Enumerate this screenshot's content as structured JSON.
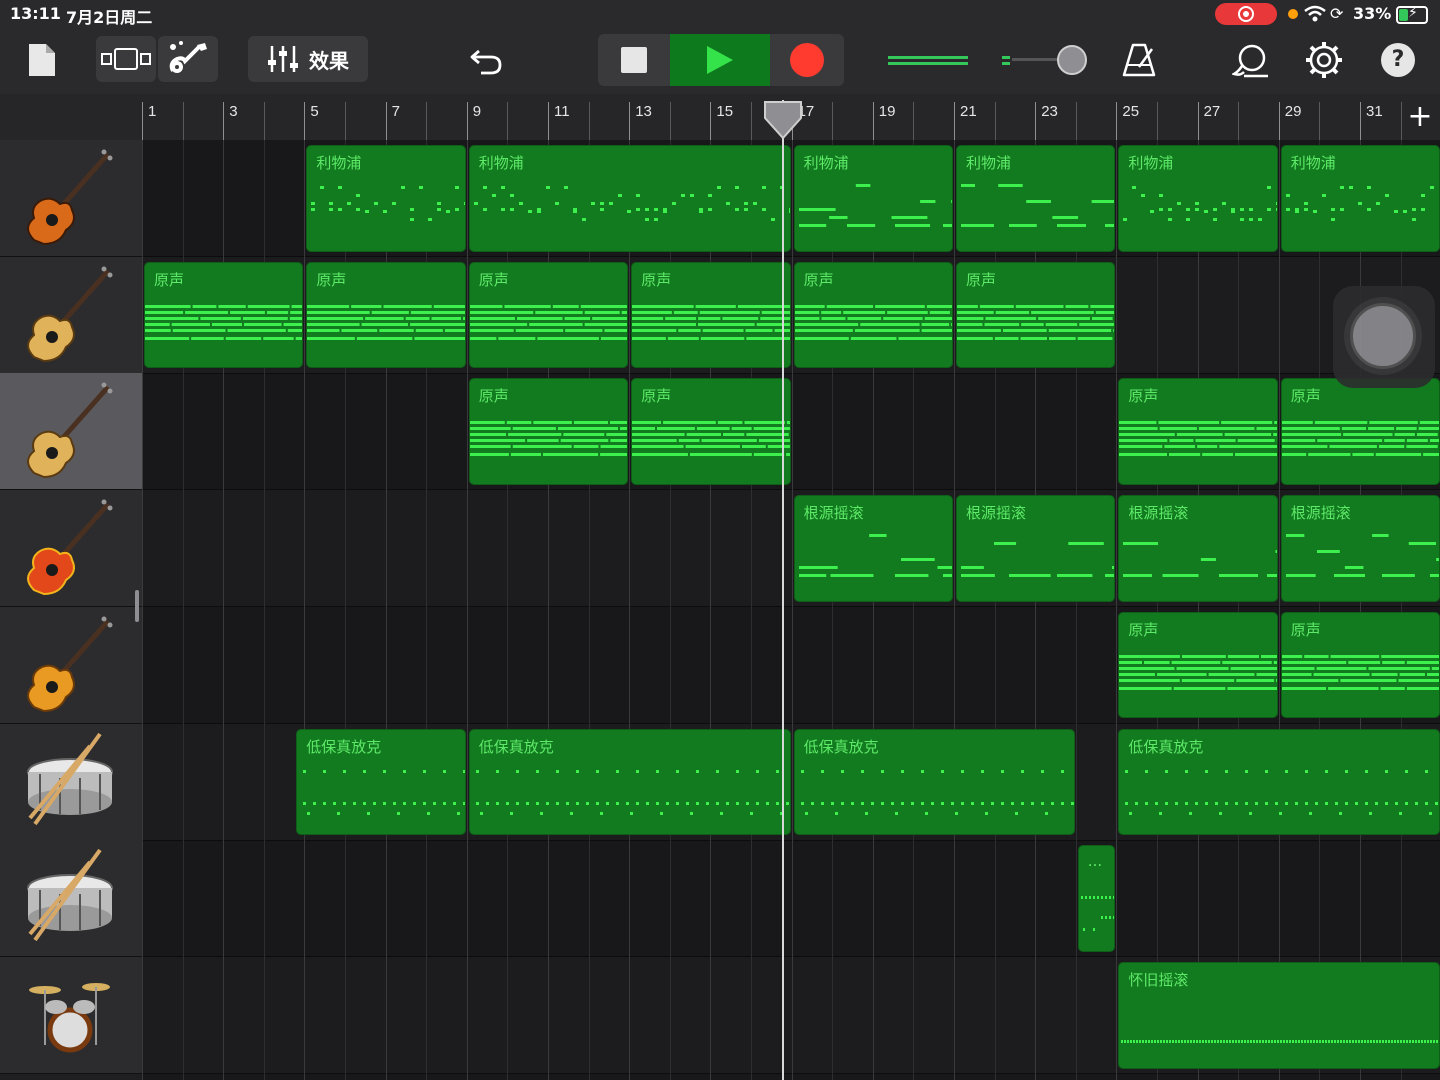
{
  "status_bar": {
    "time": "13:11",
    "date": "7月2日周二",
    "battery_percent": "33%",
    "battery_level": 0.33,
    "recording_indicator": "screen-recording-icon",
    "colors": {
      "record_pill": "#e8383a",
      "battery_fill": "#34c759",
      "mic_dot": "#ff9f0a"
    }
  },
  "toolbar": {
    "effects_label": "效果",
    "icons": [
      "document-icon",
      "view-toggle-icon",
      "instrument-guitar-icon",
      "mixer-sliders-icon",
      "undo-icon",
      "stop-icon",
      "play-icon",
      "record-icon",
      "master-volume-slider",
      "metronome-icon",
      "loop-browser-icon",
      "settings-gear-icon",
      "help-icon"
    ],
    "master_volume_level": 0.9,
    "colors": {
      "play": "#0e7a1e",
      "record": "#ff3b30",
      "volume": "#34c759"
    }
  },
  "ruler": {
    "bar_labels": [
      "1",
      "3",
      "5",
      "7",
      "9",
      "11",
      "13",
      "15",
      "17",
      "19",
      "21",
      "23",
      "25",
      "27",
      "29",
      "31"
    ],
    "playhead_bar": 16.8,
    "add_label": "+"
  },
  "tracks": [
    {
      "instrument": "electric-guitar-sunburst-icon",
      "selected": false
    },
    {
      "instrument": "acoustic-guitar-icon",
      "selected": false
    },
    {
      "instrument": "acoustic-guitar-icon",
      "selected": true
    },
    {
      "instrument": "electric-guitar-red-icon",
      "selected": false
    },
    {
      "instrument": "electric-guitar-gold-icon",
      "selected": false
    },
    {
      "instrument": "snare-drum-icon",
      "selected": false
    },
    {
      "instrument": "snare-drum-icon",
      "selected": false
    },
    {
      "instrument": "drum-kit-icon",
      "selected": false
    }
  ],
  "regions": [
    {
      "track": 0,
      "start": 5,
      "end": 9,
      "name": "利物浦",
      "pattern": "dots"
    },
    {
      "track": 0,
      "start": 9,
      "end": 17,
      "name": "利物浦",
      "pattern": "dots"
    },
    {
      "track": 0,
      "start": 17,
      "end": 21,
      "name": "利物浦",
      "pattern": "dash"
    },
    {
      "track": 0,
      "start": 21,
      "end": 25,
      "name": "利物浦",
      "pattern": "dash"
    },
    {
      "track": 0,
      "start": 25,
      "end": 29,
      "name": "利物浦",
      "pattern": "dots"
    },
    {
      "track": 0,
      "start": 29,
      "end": 33,
      "name": "利物浦",
      "pattern": "dots"
    },
    {
      "track": 1,
      "start": 1,
      "end": 5,
      "name": "原声",
      "pattern": "lines"
    },
    {
      "track": 1,
      "start": 5,
      "end": 9,
      "name": "原声",
      "pattern": "lines"
    },
    {
      "track": 1,
      "start": 9,
      "end": 13,
      "name": "原声",
      "pattern": "lines"
    },
    {
      "track": 1,
      "start": 13,
      "end": 17,
      "name": "原声",
      "pattern": "lines"
    },
    {
      "track": 1,
      "start": 17,
      "end": 21,
      "name": "原声",
      "pattern": "lines"
    },
    {
      "track": 1,
      "start": 21,
      "end": 25,
      "name": "原声",
      "pattern": "lines"
    },
    {
      "track": 2,
      "start": 9,
      "end": 13,
      "name": "原声",
      "pattern": "lines"
    },
    {
      "track": 2,
      "start": 13,
      "end": 17,
      "name": "原声",
      "pattern": "lines"
    },
    {
      "track": 2,
      "start": 25,
      "end": 29,
      "name": "原声",
      "pattern": "lines"
    },
    {
      "track": 2,
      "start": 29,
      "end": 33,
      "name": "原声",
      "pattern": "lines"
    },
    {
      "track": 3,
      "start": 17,
      "end": 21,
      "name": "根源摇滚",
      "pattern": "dash"
    },
    {
      "track": 3,
      "start": 21,
      "end": 25,
      "name": "根源摇滚",
      "pattern": "dash"
    },
    {
      "track": 3,
      "start": 25,
      "end": 29,
      "name": "根源摇滚",
      "pattern": "dash"
    },
    {
      "track": 3,
      "start": 29,
      "end": 33,
      "name": "根源摇滚",
      "pattern": "dash"
    },
    {
      "track": 4,
      "start": 25,
      "end": 29,
      "name": "原声",
      "pattern": "lines"
    },
    {
      "track": 4,
      "start": 29,
      "end": 33,
      "name": "原声",
      "pattern": "lines"
    },
    {
      "track": 5,
      "start": 4.75,
      "end": 9,
      "name": "低保真放克",
      "pattern": "drums"
    },
    {
      "track": 5,
      "start": 9,
      "end": 17,
      "name": "低保真放克",
      "pattern": "drums"
    },
    {
      "track": 5,
      "start": 17,
      "end": 24,
      "name": "低保真放克",
      "pattern": "drums"
    },
    {
      "track": 5,
      "start": 25,
      "end": 33,
      "name": "低保真放克",
      "pattern": "drums"
    },
    {
      "track": 6,
      "start": 24,
      "end": 25,
      "name": "...",
      "pattern": "fill"
    },
    {
      "track": 7,
      "start": 25,
      "end": 33,
      "name": "怀旧摇滚",
      "pattern": "kit"
    }
  ],
  "colors": {
    "region": "#127a1f",
    "region_text": "#5eea68",
    "note": "#3ef04d"
  }
}
